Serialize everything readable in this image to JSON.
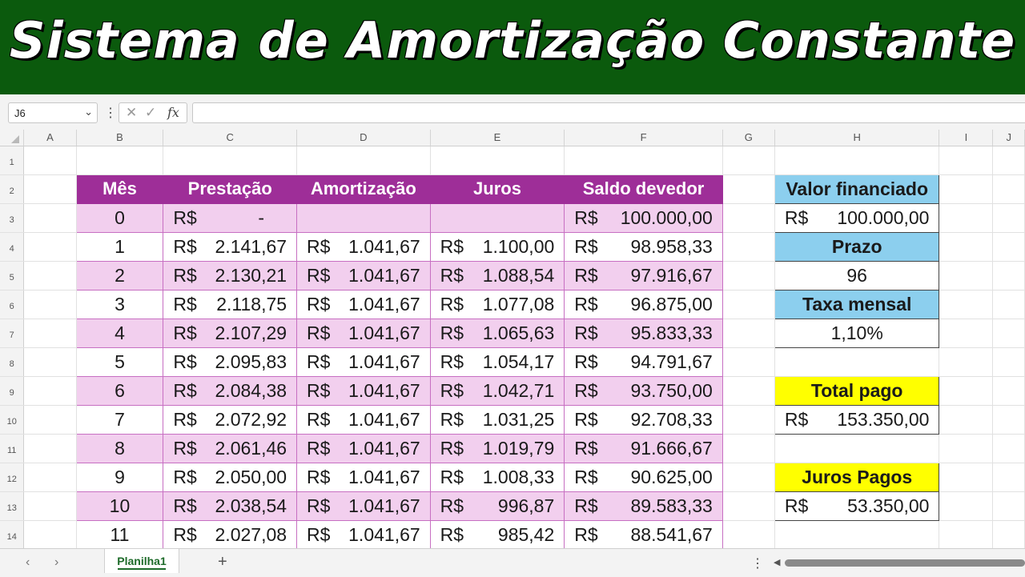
{
  "banner_title": "Sistema de Amortização Constante",
  "formula_bar": {
    "name_box": "J6",
    "fx_label": "fx",
    "cancel_icon": "x-icon",
    "enter_icon": "check-icon",
    "formula": ""
  },
  "columns": [
    "A",
    "B",
    "C",
    "D",
    "E",
    "F",
    "G",
    "H",
    "I",
    "J"
  ],
  "rows": [
    "1",
    "2",
    "3",
    "4",
    "5",
    "6",
    "7",
    "8",
    "9",
    "10",
    "11",
    "12",
    "13",
    "14"
  ],
  "table": {
    "headers": [
      "Mês",
      "Prestação",
      "Amortização",
      "Juros",
      "Saldo devedor"
    ],
    "currency": "R$",
    "dash": "-",
    "rows": [
      {
        "mes": "0",
        "prest": "",
        "amort": "",
        "juros": "",
        "saldo": "100.000,00"
      },
      {
        "mes": "1",
        "prest": "2.141,67",
        "amort": "1.041,67",
        "juros": "1.100,00",
        "saldo": "98.958,33"
      },
      {
        "mes": "2",
        "prest": "2.130,21",
        "amort": "1.041,67",
        "juros": "1.088,54",
        "saldo": "97.916,67"
      },
      {
        "mes": "3",
        "prest": "2.118,75",
        "amort": "1.041,67",
        "juros": "1.077,08",
        "saldo": "96.875,00"
      },
      {
        "mes": "4",
        "prest": "2.107,29",
        "amort": "1.041,67",
        "juros": "1.065,63",
        "saldo": "95.833,33"
      },
      {
        "mes": "5",
        "prest": "2.095,83",
        "amort": "1.041,67",
        "juros": "1.054,17",
        "saldo": "94.791,67"
      },
      {
        "mes": "6",
        "prest": "2.084,38",
        "amort": "1.041,67",
        "juros": "1.042,71",
        "saldo": "93.750,00"
      },
      {
        "mes": "7",
        "prest": "2.072,92",
        "amort": "1.041,67",
        "juros": "1.031,25",
        "saldo": "92.708,33"
      },
      {
        "mes": "8",
        "prest": "2.061,46",
        "amort": "1.041,67",
        "juros": "1.019,79",
        "saldo": "91.666,67"
      },
      {
        "mes": "9",
        "prest": "2.050,00",
        "amort": "1.041,67",
        "juros": "1.008,33",
        "saldo": "90.625,00"
      },
      {
        "mes": "10",
        "prest": "2.038,54",
        "amort": "1.041,67",
        "juros": "996,87",
        "saldo": "89.583,33"
      },
      {
        "mes": "11",
        "prest": "2.027,08",
        "amort": "1.041,67",
        "juros": "985,42",
        "saldo": "88.541,67"
      }
    ]
  },
  "summary": {
    "valor_label": "Valor financiado",
    "valor_value": "100.000,00",
    "prazo_label": "Prazo",
    "prazo_value": "96",
    "taxa_label": "Taxa mensal",
    "taxa_value": "1,10%",
    "total_label": "Total pago",
    "total_value": "153.350,00",
    "juros_label": "Juros Pagos",
    "juros_value": "53.350,00"
  },
  "sheet_tabs": [
    "Planilha1"
  ],
  "colors": {
    "banner": "#0b5a0d",
    "header_purple": "#9e2e98",
    "row_pink": "#f2cfee",
    "box_blue": "#8ccfee",
    "box_yellow": "#ffff00"
  }
}
